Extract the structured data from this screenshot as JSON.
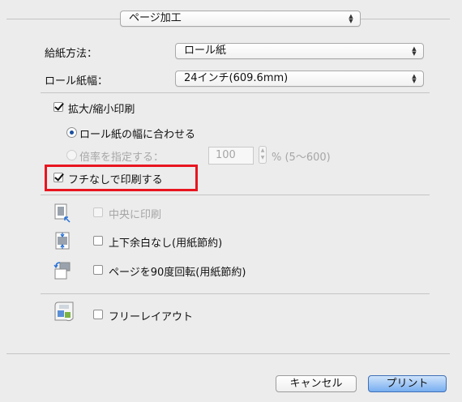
{
  "section_popup": {
    "value": "ページ加工"
  },
  "paper_feed": {
    "label": "給紙方法：",
    "value": "ロール紙"
  },
  "roll_width": {
    "label": "ロール紙幅：",
    "value": "24インチ(609.6mm)"
  },
  "enlarge_reduce": {
    "label": "拡大/縮小印刷",
    "checked": true
  },
  "fit_roll_width": {
    "label": "ロール紙の幅に合わせる",
    "selected": true
  },
  "scaling": {
    "label": "倍率を指定する：",
    "value": "100",
    "unit": "% (5〜600)",
    "enabled": false
  },
  "borderless": {
    "label": "フチなしで印刷する",
    "checked": true,
    "highlight_color": "#e8151f"
  },
  "center_print": {
    "label": "中央に印刷",
    "checked": false,
    "enabled": false
  },
  "no_top_bottom_margin": {
    "label": "上下余白なし(用紙節約)",
    "checked": false
  },
  "rotate_90": {
    "label": "ページを90度回転(用紙節約)",
    "checked": false
  },
  "free_layout": {
    "label": "フリーレイアウト",
    "checked": false
  },
  "buttons": {
    "cancel": "キャンセル",
    "print": "プリント"
  },
  "icons": {
    "center": "center-print-icon",
    "margin": "margin-saving-icon",
    "rotate": "rotate-page-icon",
    "layout": "free-layout-icon"
  }
}
